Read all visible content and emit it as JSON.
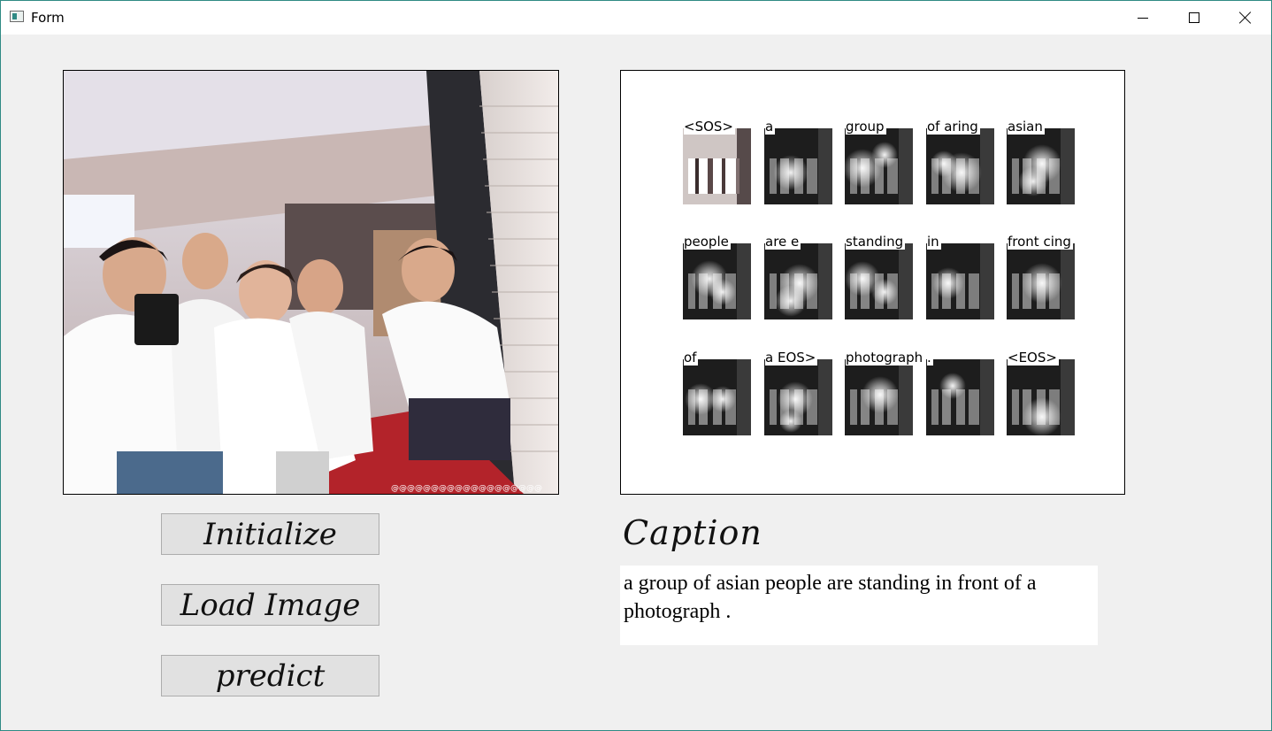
{
  "window": {
    "title": "Form",
    "controls": [
      "minimize-icon",
      "maximize-icon",
      "close-icon"
    ]
  },
  "attention": {
    "cells": [
      {
        "word": "<SOS>"
      },
      {
        "word": "a"
      },
      {
        "word": "group"
      },
      {
        "word": "of aring"
      },
      {
        "word": "asian"
      },
      {
        "word": "people"
      },
      {
        "word": "are e"
      },
      {
        "word": "standing"
      },
      {
        "word": "in"
      },
      {
        "word": "front cing"
      },
      {
        "word": "of"
      },
      {
        "word": "a EOS>"
      },
      {
        "word": "photograph"
      },
      {
        "word": "."
      },
      {
        "word": "<EOS>"
      }
    ]
  },
  "caption": {
    "heading": "Caption",
    "text": "a group of asian people are standing in front of a photograph ."
  },
  "buttons": {
    "initialize": "Initialize",
    "load_image": "Load Image",
    "predict": "predict"
  }
}
